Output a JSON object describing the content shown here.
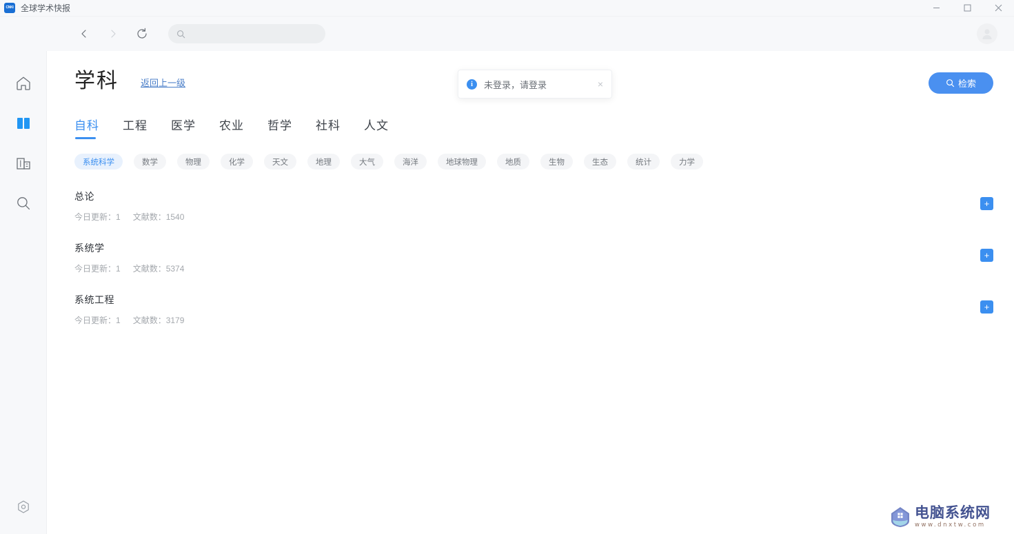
{
  "window": {
    "app_name": "全球学术快报",
    "app_icon_text": "CNKI",
    "minimize_label": "最小化",
    "maximize_label": "最大化",
    "close_label": "关闭"
  },
  "browser_nav": {
    "back_label": "后退",
    "forward_label": "前进",
    "reload_label": "刷新",
    "search_value": "",
    "search_placeholder": "",
    "avatar_label": "用户头像"
  },
  "rail": {
    "items": [
      {
        "name": "home",
        "label": "首页",
        "active": false
      },
      {
        "name": "library",
        "label": "学科",
        "active": true
      },
      {
        "name": "institution",
        "label": "机构",
        "active": false
      },
      {
        "name": "search",
        "label": "检索",
        "active": false
      }
    ],
    "bottom": {
      "name": "settings",
      "label": "设置"
    }
  },
  "header": {
    "title": "学科",
    "back_link": "返回上一级"
  },
  "toast": {
    "icon": "info-icon",
    "message": "未登录，请登录",
    "close": "×"
  },
  "search_button": {
    "label": "检索",
    "icon": "search-icon",
    "color": "#4a90f0"
  },
  "tabs": [
    {
      "label": "自科",
      "active": true
    },
    {
      "label": "工程",
      "active": false
    },
    {
      "label": "医学",
      "active": false
    },
    {
      "label": "农业",
      "active": false
    },
    {
      "label": "哲学",
      "active": false
    },
    {
      "label": "社科",
      "active": false
    },
    {
      "label": "人文",
      "active": false
    }
  ],
  "chips": [
    {
      "label": "系统科学",
      "active": true
    },
    {
      "label": "数学",
      "active": false
    },
    {
      "label": "物理",
      "active": false
    },
    {
      "label": "化学",
      "active": false
    },
    {
      "label": "天文",
      "active": false
    },
    {
      "label": "地理",
      "active": false
    },
    {
      "label": "大气",
      "active": false
    },
    {
      "label": "海洋",
      "active": false
    },
    {
      "label": "地球物理",
      "active": false
    },
    {
      "label": "地质",
      "active": false
    },
    {
      "label": "生物",
      "active": false
    },
    {
      "label": "生态",
      "active": false
    },
    {
      "label": "统计",
      "active": false
    },
    {
      "label": "力学",
      "active": false
    }
  ],
  "list": {
    "update_label": "今日更新：",
    "doc_label": "文献数：",
    "add_label": "+",
    "items": [
      {
        "title": "总论",
        "updates": "1",
        "docs": "1540"
      },
      {
        "title": "系统学",
        "updates": "1",
        "docs": "5374"
      },
      {
        "title": "系统工程",
        "updates": "1",
        "docs": "3179"
      }
    ]
  },
  "watermark": {
    "title": "电脑系统网",
    "url": "www.dnxtw.com"
  },
  "colors": {
    "accent": "#3b8ff0",
    "accent_button": "#4a90f0",
    "chip_active_bg": "#e8f1fd",
    "chip_bg": "#f4f5f7",
    "chrome_bg": "#f7f8fa"
  }
}
